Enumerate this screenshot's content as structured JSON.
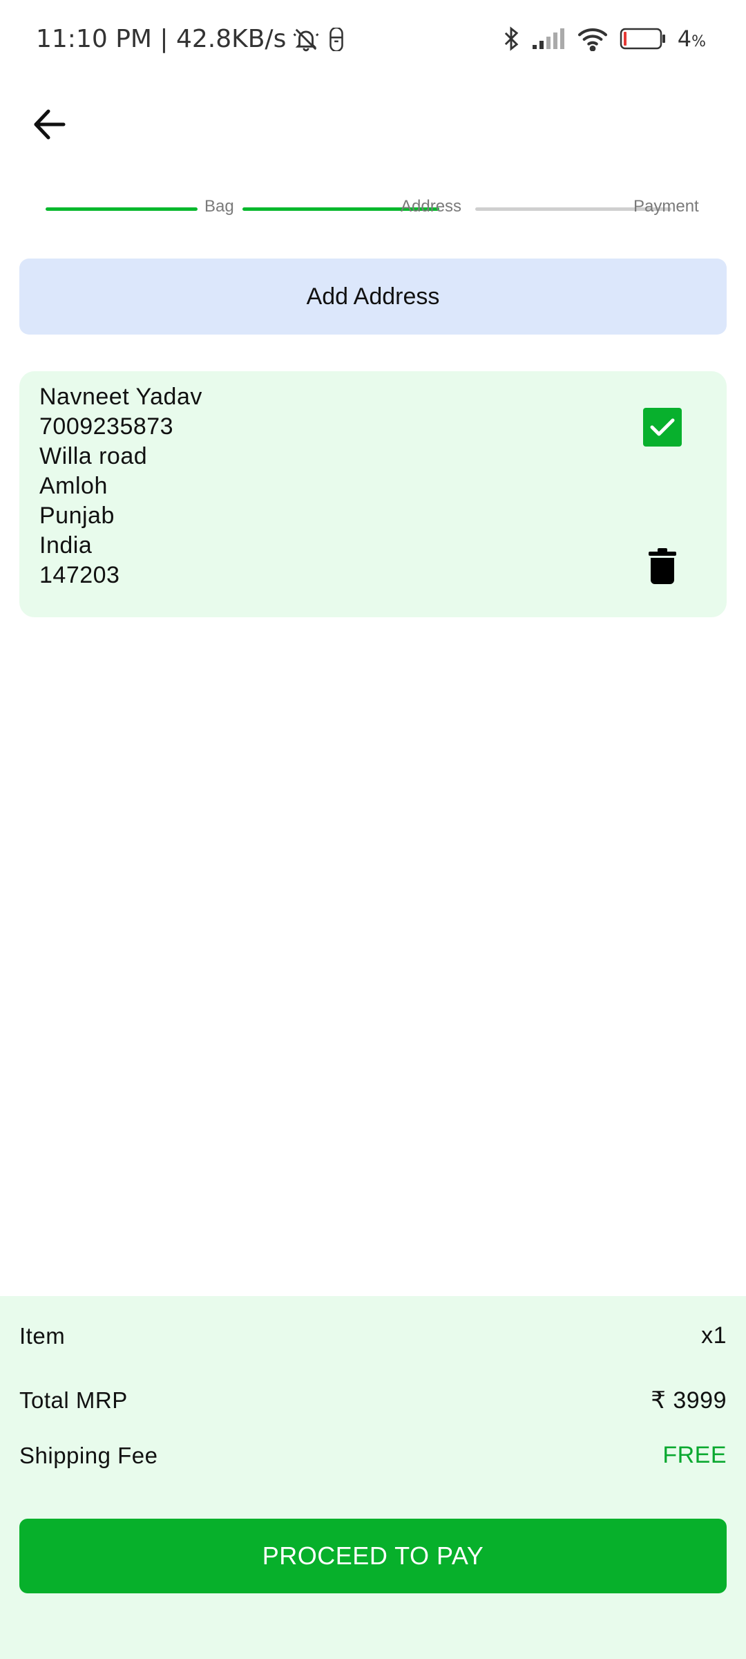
{
  "status_bar": {
    "time_speed": "11:10 PM | 42.8KB/s",
    "battery_percent": "4",
    "battery_unit": "%",
    "icons": [
      "mute-bell-icon",
      "notification-icon",
      "bluetooth-icon",
      "signal-icon",
      "wifi-icon",
      "battery-icon"
    ]
  },
  "header": {
    "back_icon": "arrow-left-icon"
  },
  "stepper": {
    "steps": [
      {
        "label": "Bag",
        "state": "complete"
      },
      {
        "label": "Address",
        "state": "complete"
      },
      {
        "label": "Payment",
        "state": "pending"
      }
    ],
    "active_color": "#08b82d",
    "inactive_color": "#cfcfcf"
  },
  "add_address": {
    "label": "Add Address"
  },
  "address": {
    "name": "Navneet Yadav",
    "phone": "7009235873",
    "street": "Willa road",
    "city": "Amloh",
    "state": "Punjab",
    "country": "India",
    "pincode": "147203",
    "selected": true,
    "icons": [
      "checkbox-checked-icon",
      "trash-icon"
    ]
  },
  "summary": {
    "item_label": "Item",
    "item_value": "x1",
    "mrp_label": "Total MRP",
    "mrp_value": "₹ 3999",
    "shipping_label": "Shipping Fee",
    "shipping_value": "FREE",
    "proceed_label": "PROCEED TO PAY"
  },
  "colors": {
    "accent_green": "#07b02b",
    "card_bg": "#e8fbec",
    "add_address_bg": "#dce7fb"
  }
}
